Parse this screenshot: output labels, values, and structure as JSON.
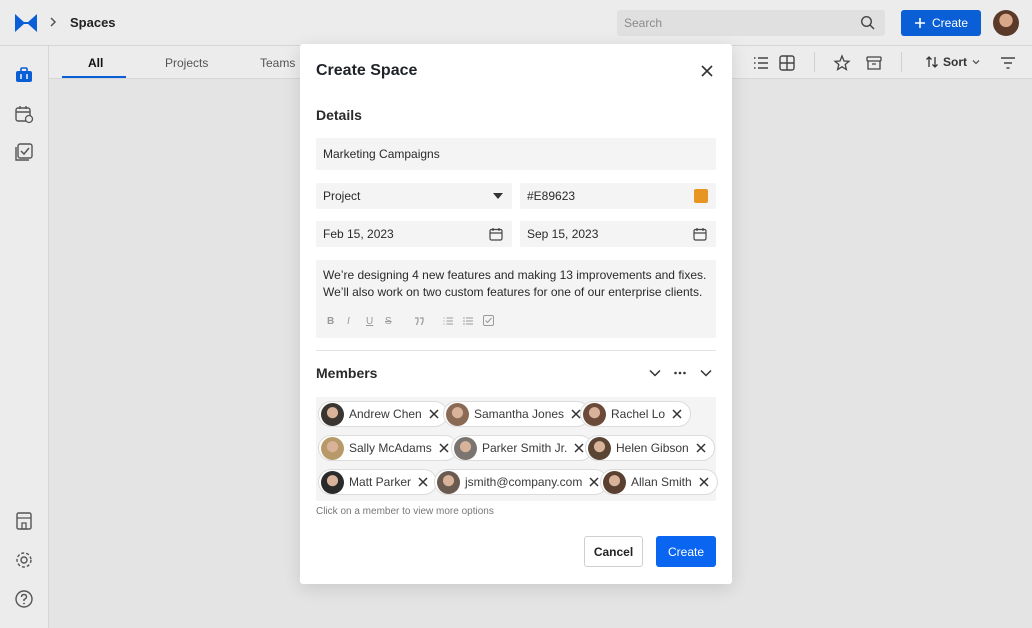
{
  "app": {
    "title": "Spaces"
  },
  "header": {
    "search_placeholder": "Search",
    "create_label": "Create",
    "accent": "#0a5fd6"
  },
  "tabs": [
    {
      "label": "All",
      "active": true
    },
    {
      "label": "Projects",
      "active": false
    },
    {
      "label": "Teams",
      "active": false
    }
  ],
  "toolbar": {
    "sort_label": "Sort"
  },
  "modal": {
    "title": "Create Space",
    "details_title": "Details",
    "name_value": "Marketing Campaigns",
    "type_value": "Project",
    "color_value": "#E89623",
    "start_date": "Feb 15, 2023",
    "end_date": "Sep 15, 2023",
    "description_line1": "We’re designing 4 new features and making 13 improvements and fixes.",
    "description_line2": "We’ll also work on two custom features for one of our enterprise clients.",
    "format_buttons": [
      "B",
      "I",
      "U",
      "S"
    ],
    "members_title": "Members",
    "members": [
      {
        "name": "Andrew Chen",
        "avatar_color": "#3a3530"
      },
      {
        "name": "Samantha Jones",
        "avatar_color": "#8a6a55"
      },
      {
        "name": "Rachel Lo",
        "avatar_color": "#6b4a3a"
      },
      {
        "name": "Sally McAdams",
        "avatar_color": "#b89a6a"
      },
      {
        "name": "Parker Smith Jr.",
        "avatar_color": "#7a7570"
      },
      {
        "name": "Helen Gibson",
        "avatar_color": "#5a4535"
      },
      {
        "name": "Matt Parker",
        "avatar_color": "#2a2a2a"
      },
      {
        "name": "jsmith@company.com",
        "avatar_color": "#6a5a50"
      },
      {
        "name": "Allan Smith",
        "avatar_color": "#5a4030"
      }
    ],
    "hint": "Click on a member to view more options",
    "cancel_label": "Cancel",
    "create_label": "Create"
  }
}
